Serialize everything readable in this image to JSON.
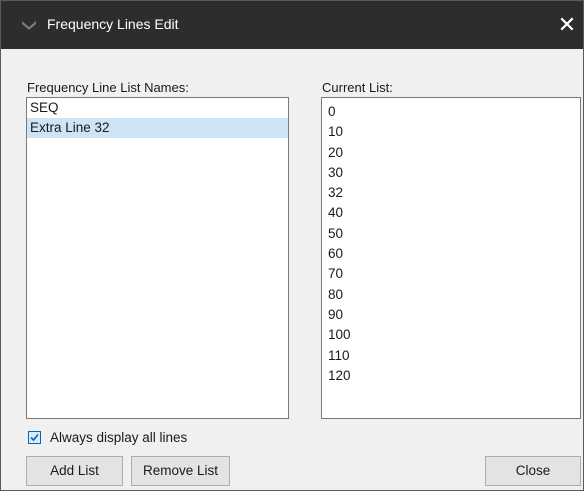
{
  "window": {
    "title": "Frequency Lines Edit",
    "close_glyph": "✕"
  },
  "left_panel": {
    "label": "Frequency Line List Names:",
    "items": [
      {
        "label": "SEQ",
        "selected": false
      },
      {
        "label": "Extra Line 32",
        "selected": true
      }
    ]
  },
  "right_panel": {
    "label": "Current List:",
    "values": [
      "0",
      "10",
      "20",
      "30",
      "32",
      "40",
      "50",
      "60",
      "70",
      "80",
      "90",
      "100",
      "110",
      "120"
    ]
  },
  "options": {
    "always_display_label": "Always display all lines",
    "always_display_checked": true
  },
  "buttons": {
    "add_list": "Add List",
    "remove_list": "Remove List",
    "close": "Close"
  },
  "colors": {
    "titlebar": "#2d2d2d",
    "selection": "#cde4f7",
    "checkbox_accent": "#0a64b4"
  },
  "icons": {
    "app": "app-chevron-icon",
    "check": "checkmark-icon",
    "close": "close-icon"
  }
}
